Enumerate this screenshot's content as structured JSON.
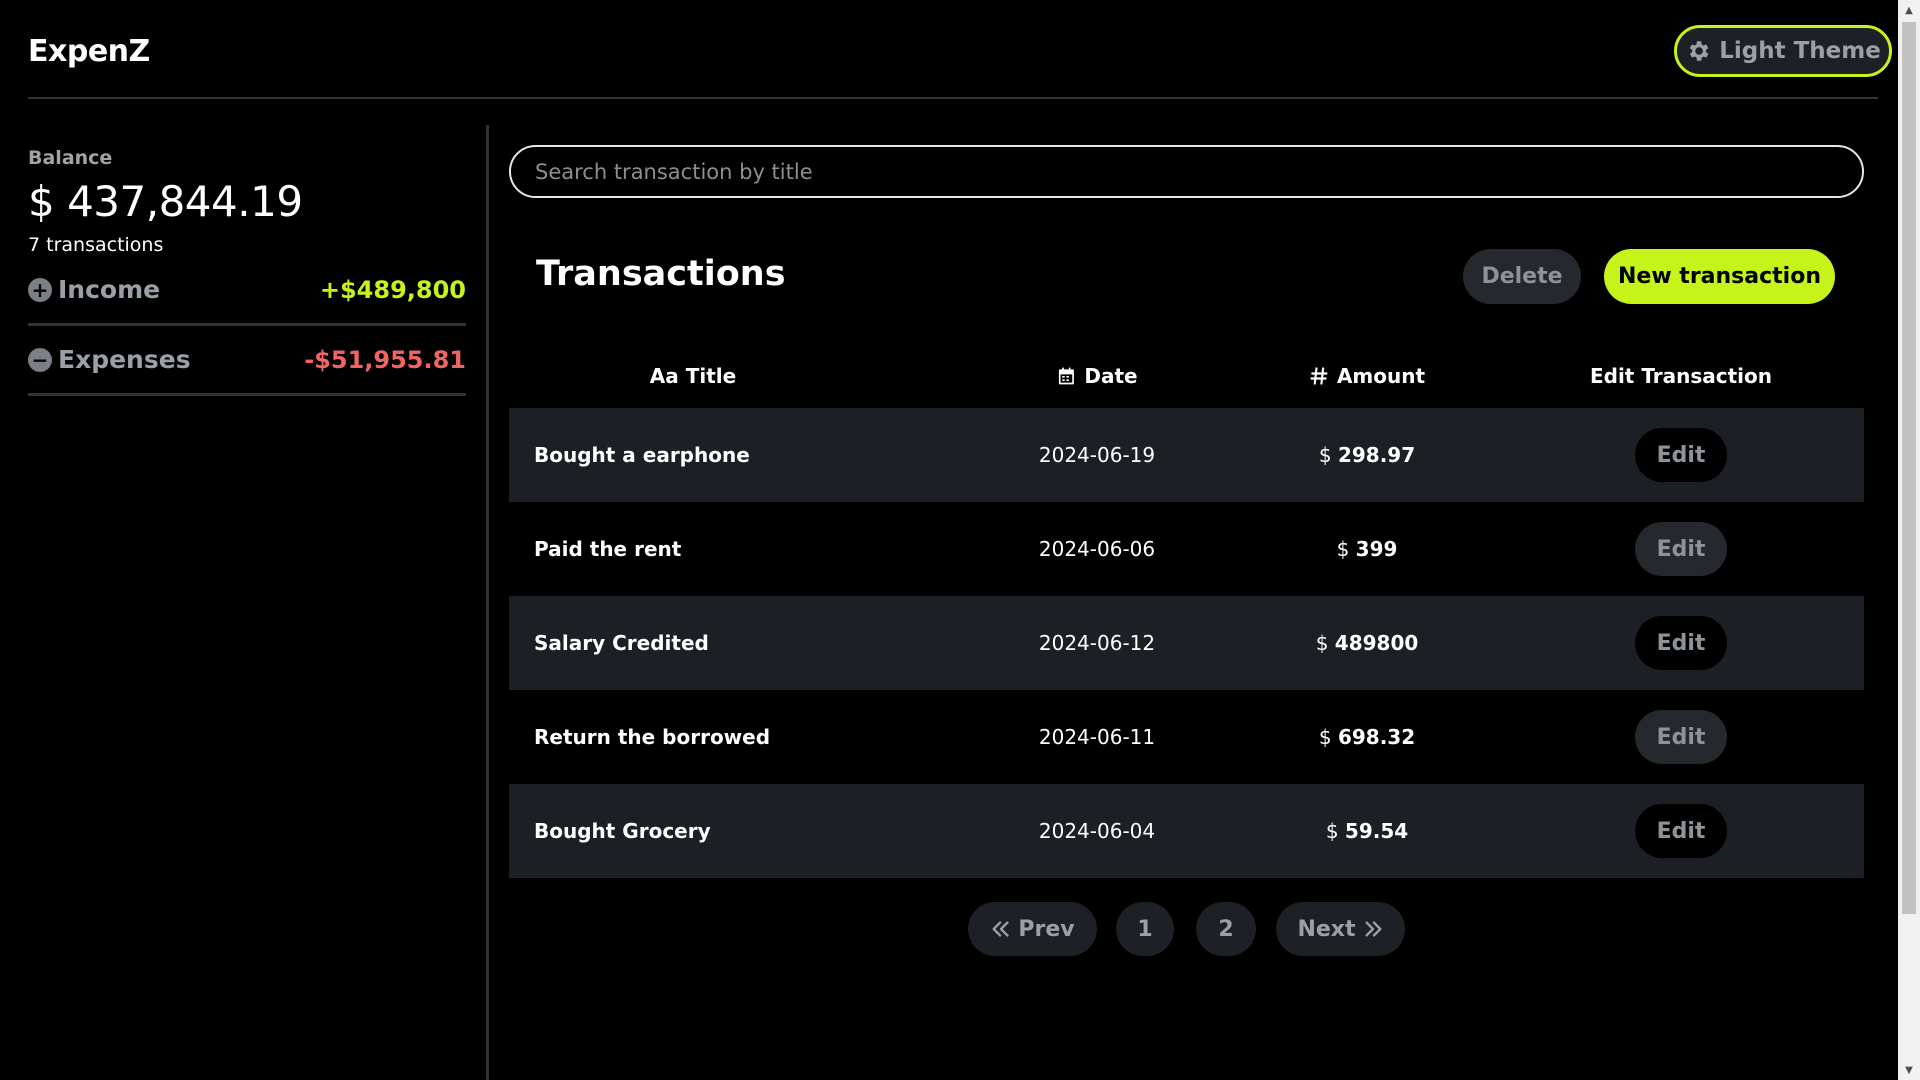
{
  "app": {
    "brand": "ExpenZ",
    "theme_button_label": "Light Theme"
  },
  "sidebar": {
    "balance_label": "Balance",
    "balance_value": "$ 437,844.19",
    "transaction_count": "7 transactions",
    "income": {
      "icon": "plus-circle-icon",
      "label": "Income",
      "value": "+$489,800"
    },
    "expenses": {
      "icon": "minus-circle-icon",
      "label": "Expenses",
      "value": "-$51,955.81"
    }
  },
  "search": {
    "placeholder": "Search transaction by title",
    "value": ""
  },
  "toolbar": {
    "title": "Transactions",
    "delete_label": "Delete",
    "new_label": "New transaction"
  },
  "table": {
    "headers": {
      "title": "Aa Title",
      "date": "Date",
      "amount": "Amount",
      "edit": "Edit Transaction"
    },
    "rows": [
      {
        "title": "Bought a earphone",
        "date": "2024-06-19",
        "currency": "$",
        "amount": "298.97",
        "edit_label": "Edit"
      },
      {
        "title": "Paid the rent",
        "date": "2024-06-06",
        "currency": "$",
        "amount": "399",
        "edit_label": "Edit"
      },
      {
        "title": "Salary Credited",
        "date": "2024-06-12",
        "currency": "$",
        "amount": "489800",
        "edit_label": "Edit"
      },
      {
        "title": "Return the borrowed",
        "date": "2024-06-11",
        "currency": "$",
        "amount": "698.32",
        "edit_label": "Edit"
      },
      {
        "title": "Bought Grocery",
        "date": "2024-06-04",
        "currency": "$",
        "amount": "59.54",
        "edit_label": "Edit"
      }
    ]
  },
  "pagination": {
    "prev_label": "Prev",
    "pages": [
      "1",
      "2"
    ],
    "next_label": "Next"
  },
  "colors": {
    "accent": "#c6f31a",
    "expense": "#f06464",
    "row_alt": "#1c1f23",
    "background": "#000000"
  }
}
